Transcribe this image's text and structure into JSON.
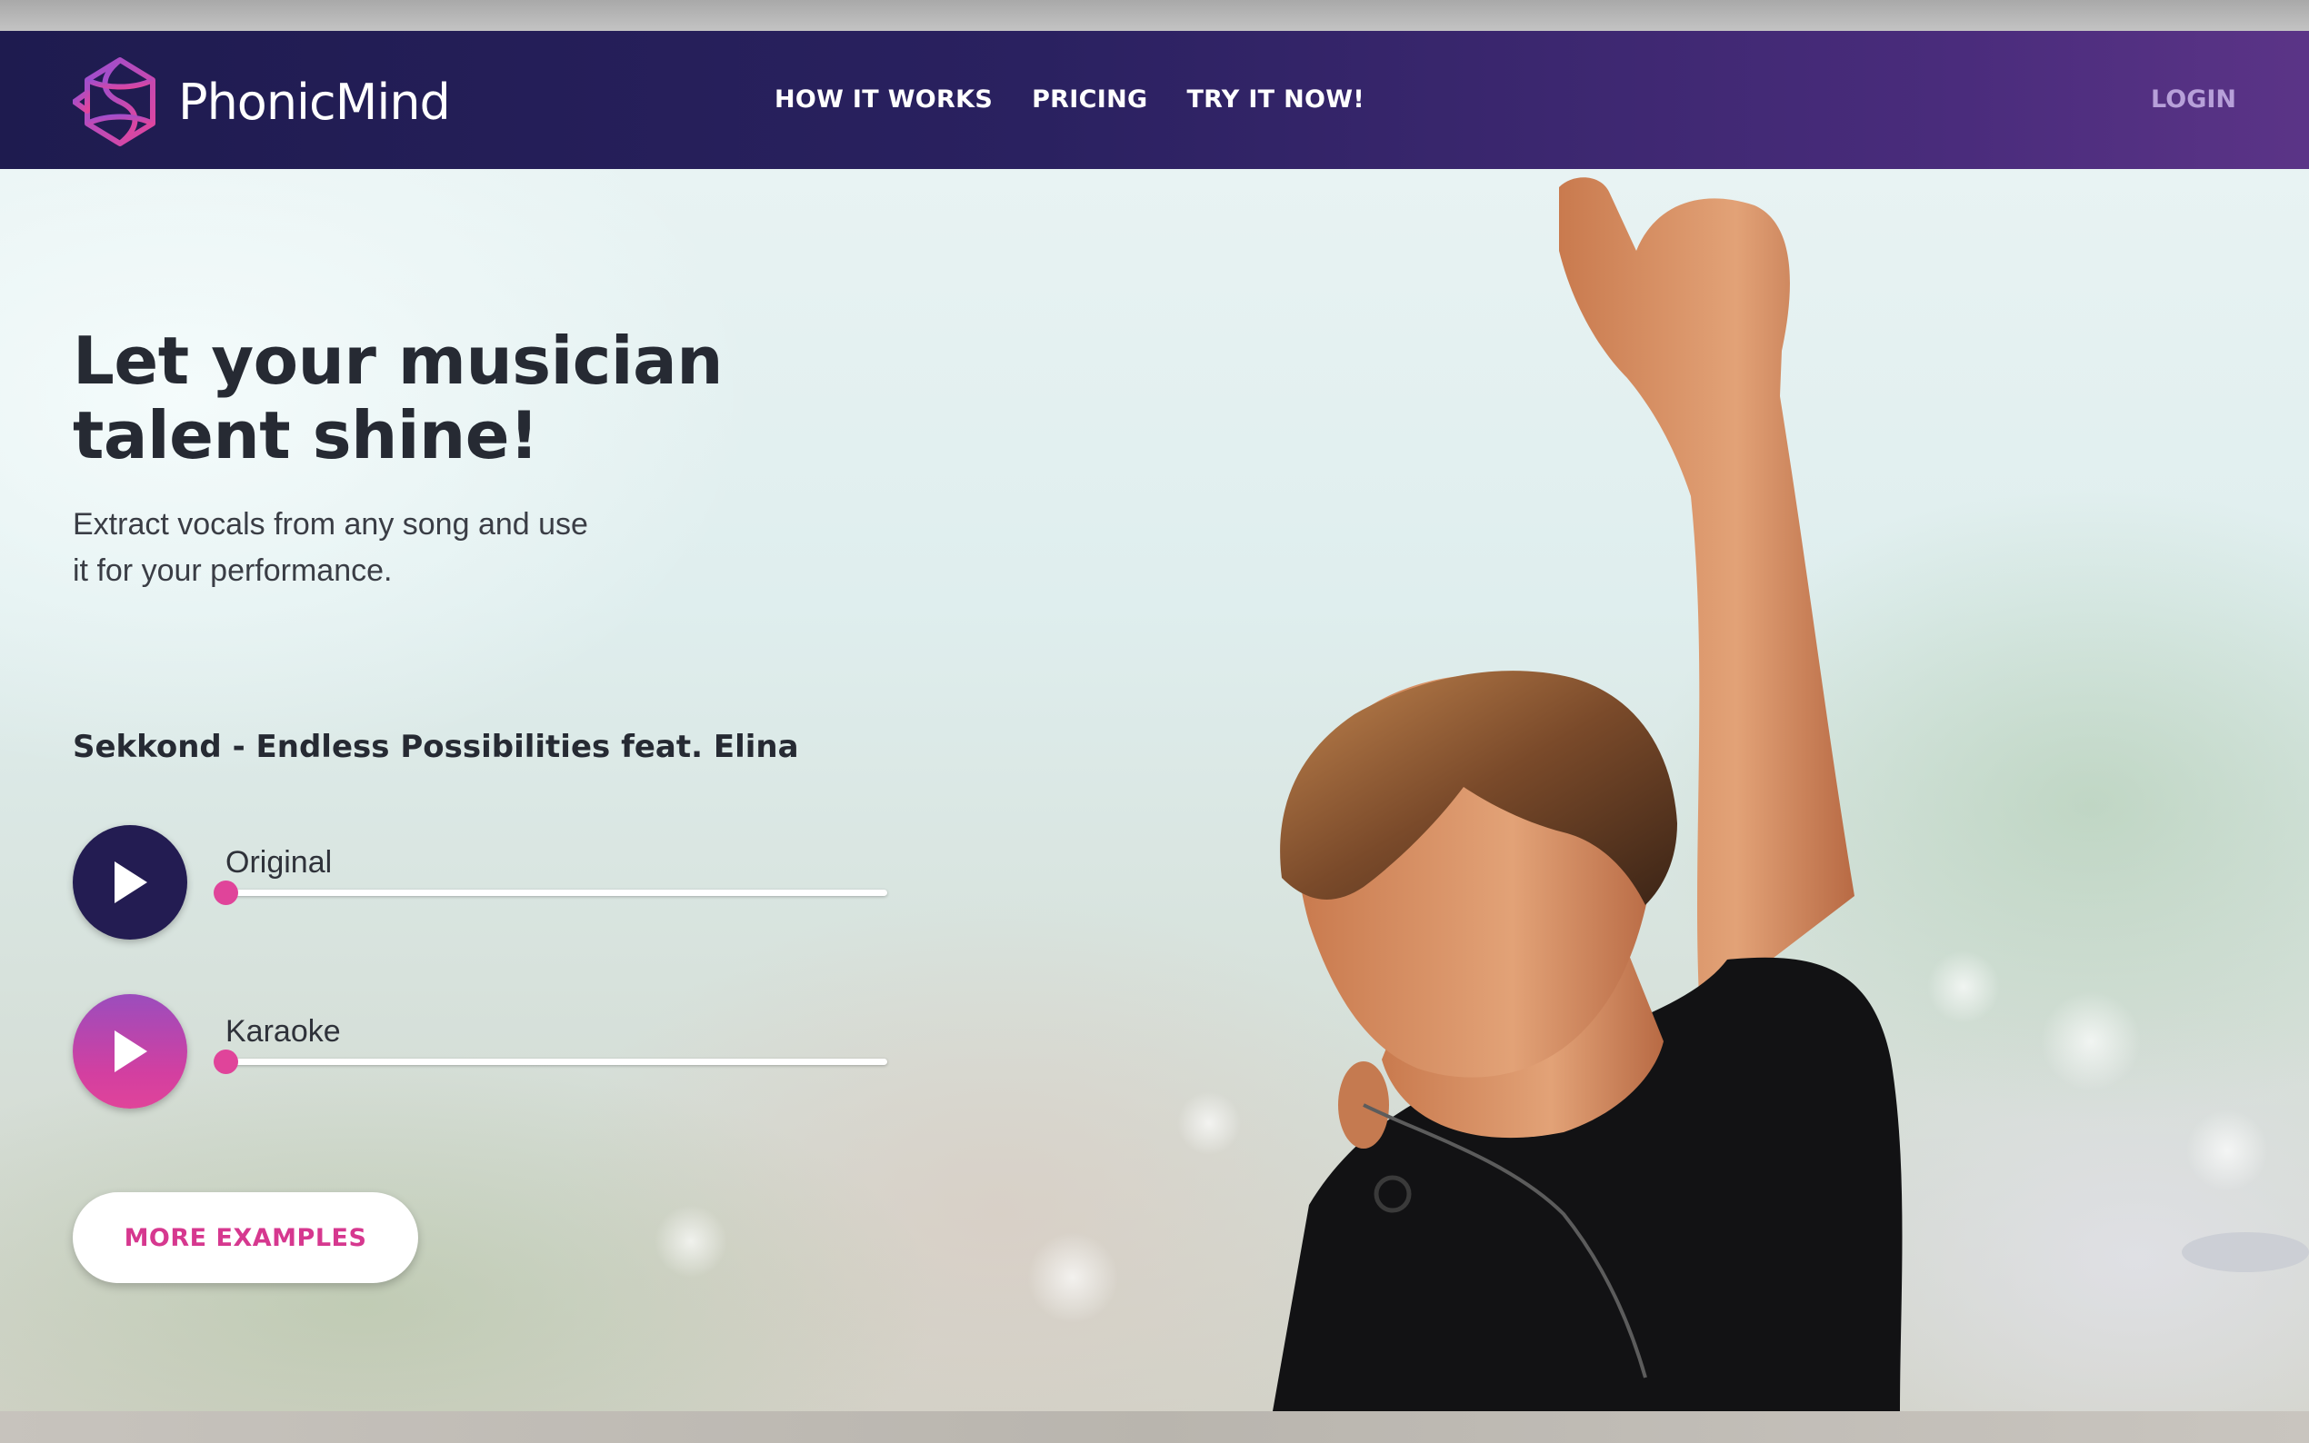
{
  "brand": {
    "name": "PhonicMind",
    "logo_icon": "phonicmind-logo-icon"
  },
  "nav": {
    "links": [
      {
        "label": "HOW IT WORKS"
      },
      {
        "label": "PRICING"
      },
      {
        "label": "TRY IT NOW!"
      }
    ],
    "login_label": "LOGIN"
  },
  "hero": {
    "headline_line1": "Let your musician",
    "headline_line2": "talent shine!",
    "subtext_line1": "Extract vocals from any song and use",
    "subtext_line2": "it for your performance.",
    "song_title": "Sekkond - Endless Possibilities feat. Elina",
    "players": [
      {
        "label": "Original",
        "icon": "play-icon",
        "progress": 0
      },
      {
        "label": "Karaoke",
        "icon": "play-icon",
        "progress": 0
      }
    ],
    "more_button_label": "MORE EXAMPLES"
  },
  "colors": {
    "nav_gradient_start": "#1e1b4f",
    "nav_gradient_end": "#5b3487",
    "accent_pink": "#e0449a",
    "dark_play_button": "#231c52",
    "headline_text": "#262a33"
  }
}
